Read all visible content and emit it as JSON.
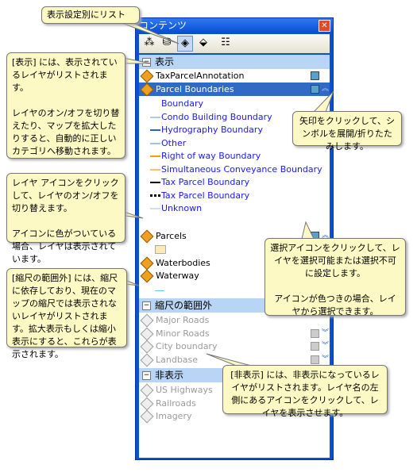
{
  "window": {
    "title": "コンテンツ",
    "close": "✕"
  },
  "groups": {
    "visible": "表示",
    "out_of_range": "縮尺の範囲外",
    "hidden": "非表示"
  },
  "layers_visible": [
    "TaxParcelAnnotation",
    "Parcel Boundaries",
    "Parcels",
    "Waterbodies",
    "Waterway"
  ],
  "legend": [
    {
      "label": "Boundary",
      "color": "#ffffff",
      "style": "none"
    },
    {
      "label": "Condo Building Boundary",
      "color": "#aaccee",
      "style": "solid"
    },
    {
      "label": "Hydrography Boundary",
      "color": "#2266cc",
      "style": "solid"
    },
    {
      "label": "Other",
      "color": "#99c4ee",
      "style": "solid"
    },
    {
      "label": "Right of way Boundary",
      "color": "#ff9900",
      "style": "solid"
    },
    {
      "label": "Simultaneous Conveyance Boundary",
      "color": "#ffc060",
      "style": "solid"
    },
    {
      "label": "Tax Parcel Boundary",
      "color": "#000000",
      "style": "solid"
    },
    {
      "label": "Tax Parcel Boundary",
      "color": "#000000",
      "style": "dotted"
    },
    {
      "label": "Unknown",
      "color": "#cce0f5",
      "style": "solid"
    }
  ],
  "layers_out_of_range": [
    "Major Roads",
    "Minor Roads",
    "City boundary",
    "Landbase"
  ],
  "layers_hidden": [
    "US Highways",
    "Railroads",
    "Imagery"
  ],
  "callouts": {
    "list_by_visibility": "表示設定別にリスト",
    "visible_info": "[表示] には、表示されているレイヤがリストされます。\n\nレイヤのオン/オフを切り替えたり、マップを拡大したりすると、自動的に正しいカテゴリへ移動されます。",
    "expand_info": "矢印をクリックして、シンボルを展開/折りたたみします。",
    "toggle_info": "レイヤ アイコンをクリックして、レイヤのオン/オフを切り替えます。\n\nアイコンに色がついている場合、レイヤは表示されています。",
    "select_info": "選択アイコンをクリックして、レイヤを選択可能または選択不可に設定します。\n\nアイコンが色つきの場合、レイヤから選択できます。",
    "scale_info": "[縮尺の範囲外] には、縮尺に依存しており、現在のマップの縮尺では表示されないレイヤがリストされます。拡大表示もしくは縮小表示にすると、これらが表示されます。",
    "hidden_info": "[非表示] には、非表示になっているレイヤがリストされます。レイヤ名の左側にあるアイコンをクリックして、レイヤを表示させます。"
  }
}
